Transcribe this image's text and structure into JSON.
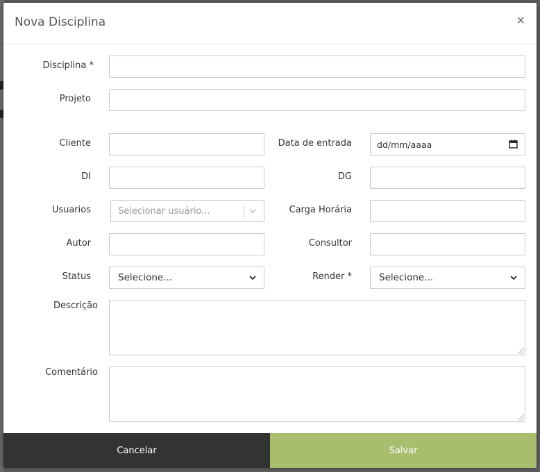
{
  "modal": {
    "title": "Nova Disciplina",
    "close_label": "×"
  },
  "fields": {
    "disciplina": {
      "label": "Disciplina *",
      "value": ""
    },
    "projeto": {
      "label": "Projeto",
      "value": ""
    },
    "cliente": {
      "label": "Cliente",
      "value": ""
    },
    "data_entrada": {
      "label": "Data de entrada",
      "placeholder": "dd/mm/aaaa"
    },
    "di": {
      "label": "DI",
      "value": ""
    },
    "dg": {
      "label": "DG",
      "value": ""
    },
    "usuarios": {
      "label": "Usuarios",
      "placeholder": "Selecionar usuário..."
    },
    "carga_horaria": {
      "label": "Carga Horária",
      "value": ""
    },
    "autor": {
      "label": "Autor",
      "value": ""
    },
    "consultor": {
      "label": "Consultor",
      "value": ""
    },
    "status": {
      "label": "Status",
      "selected": "Selecione..."
    },
    "render": {
      "label": "Render *",
      "selected": "Selecione..."
    },
    "descricao": {
      "label": "Descrição",
      "value": ""
    },
    "comentario": {
      "label": "Comentário",
      "value": ""
    }
  },
  "footer": {
    "cancel_label": "Cancelar",
    "save_label": "Salvar"
  },
  "colors": {
    "save_button": "#a8bd6e",
    "cancel_button": "#333333"
  }
}
